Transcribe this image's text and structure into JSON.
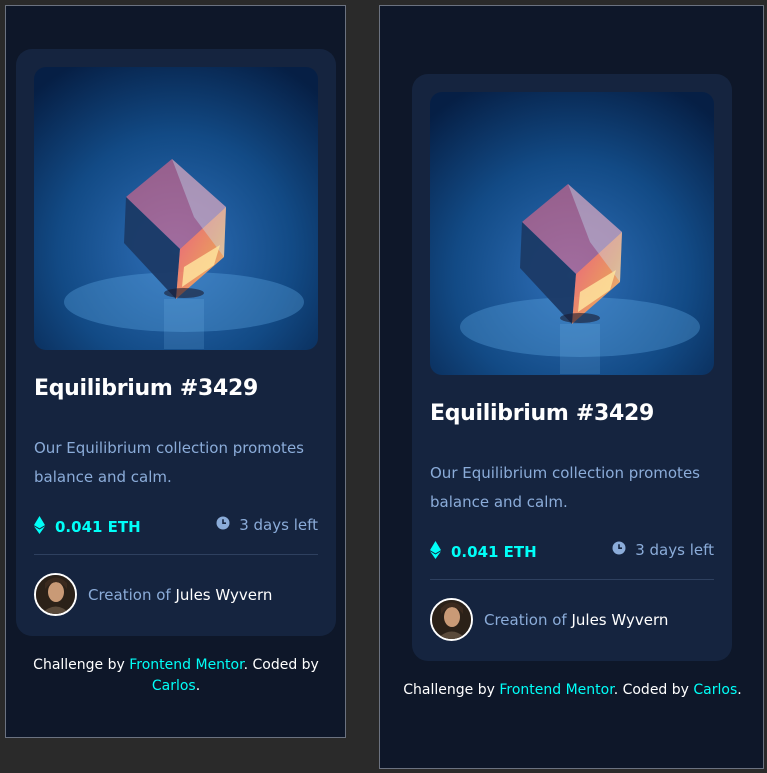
{
  "card": {
    "title": "Equilibrium #3429",
    "description": "Our Equilibrium collection promotes balance and calm.",
    "price": "0.041 ETH",
    "time_left": "3 days left",
    "creator_prefix": "Creation of",
    "creator_name": "Jules Wyvern"
  },
  "footer": {
    "challenge_prefix": "Challenge by",
    "challenge_link": "Frontend Mentor",
    "coded_by": ". Coded by",
    "author_link": "Carlos",
    "suffix": "."
  },
  "icons": {
    "eth": "ethereum-icon",
    "clock": "clock-icon"
  },
  "colors": {
    "page_bg": "#0e1729",
    "card_bg": "#15243f",
    "accent": "#00fff8",
    "soft_blue": "#8bacd9",
    "line": "#2e405f"
  }
}
